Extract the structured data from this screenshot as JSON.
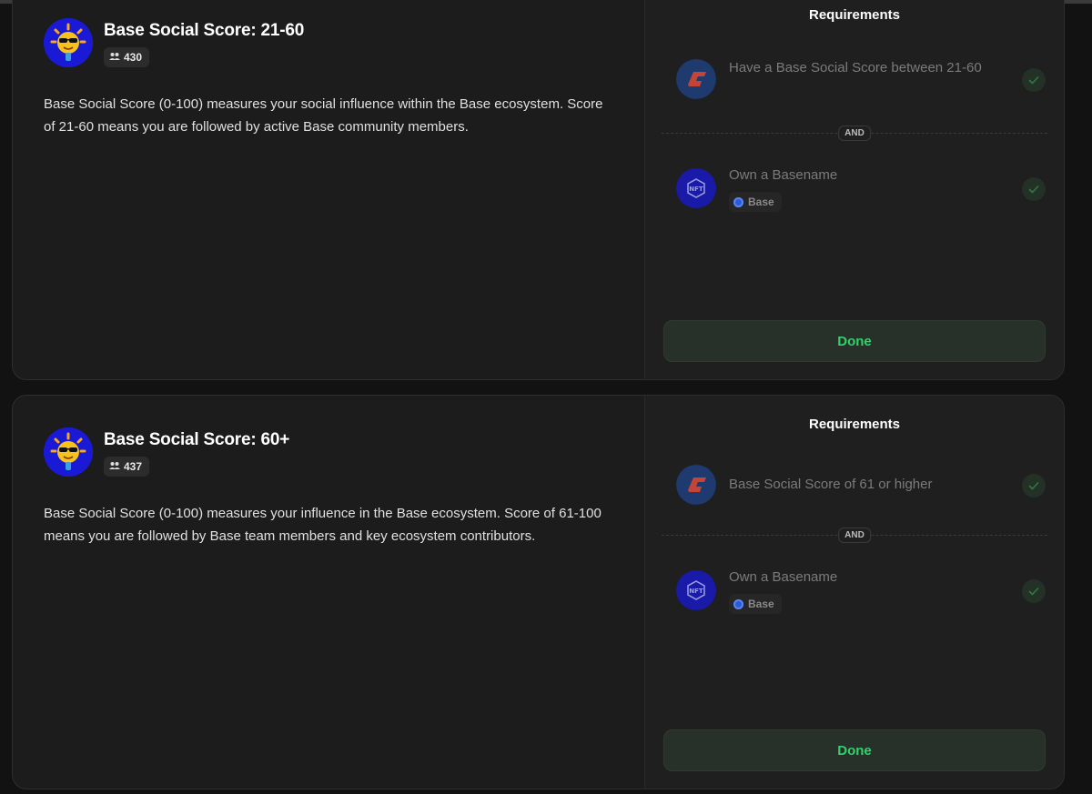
{
  "cards": [
    {
      "title": "Base Social Score: 21-60",
      "participants": "430",
      "description": "Base Social Score (0-100) measures your social influence within the Base ecosystem. Score of 21-60 means you are followed by active Base community members.",
      "requirements_title": "Requirements",
      "requirements": [
        {
          "text": "Have a Base Social Score between 21-60",
          "icon": "score-logo-icon",
          "met": true
        },
        {
          "text": "Own a Basename",
          "icon": "nft-icon",
          "chain": "Base",
          "met": true
        }
      ],
      "operator": "AND",
      "button_label": "Done"
    },
    {
      "title": "Base Social Score: 60+",
      "participants": "437",
      "description": "Base Social Score (0-100) measures your influence in the Base ecosystem. Score of 61-100 means you are followed by Base team members and key ecosystem contributors.",
      "requirements_title": "Requirements",
      "requirements": [
        {
          "text": "Base Social Score of 61 or higher",
          "icon": "score-logo-icon",
          "met": true
        },
        {
          "text": "Own a Basename",
          "icon": "nft-icon",
          "chain": "Base",
          "met": true
        }
      ],
      "operator": "AND",
      "button_label": "Done"
    }
  ],
  "colors": {
    "background": "#121212",
    "card": "#1c1c1c",
    "accent_green": "#2ed36a",
    "avatar_blue": "#1a1ad6"
  }
}
